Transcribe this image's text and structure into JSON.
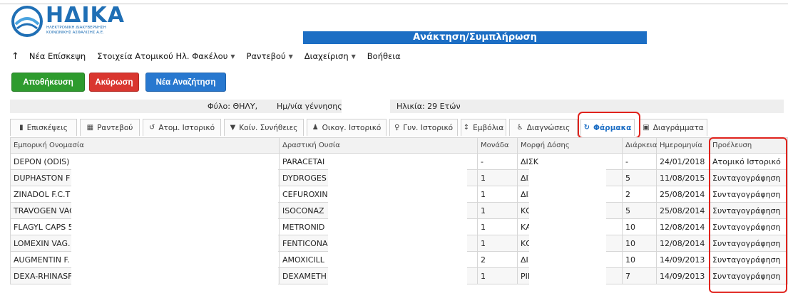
{
  "logo": {
    "word": "ΗΔΙΚΑ",
    "subtitle": "ΗΛΕΚΤΡΟΝΙΚΗ ΔΙΑΚΥΒΕΡΝΗΣΗ ΚΟΙΝΩΝΙΚΗΣ ΑΣΦΑΛΙΣΗΣ Α.Ε."
  },
  "banner": {
    "title": "Ανάκτηση/Συμπλήρωση"
  },
  "nav": {
    "items": [
      {
        "label": "Νέα Επίσκεψη"
      },
      {
        "label": "Στοιχεία Ατομικού Ηλ. Φακέλου"
      },
      {
        "label": "Ραντεβού"
      },
      {
        "label": "Διαχείριση"
      },
      {
        "label": "Βοήθεια"
      }
    ]
  },
  "buttons": {
    "save": "Αποθήκευση",
    "cancel": "Ακύρωση",
    "new_search": "Νέα Αναζήτηση"
  },
  "patient": {
    "gender": "Φύλο: ΘΗΛΥ,",
    "birth": "Ημ/νία γέννησης:",
    "age": "Ηλικία: 29 Ετών"
  },
  "tabs": [
    {
      "label": "Επισκέψεις",
      "icon": "visits-icon"
    },
    {
      "label": "Ραντεβού",
      "icon": "calendar-icon"
    },
    {
      "label": "Ατομ. Ιστορικό",
      "icon": "history-icon"
    },
    {
      "label": "Κοίν. Συνήθειες",
      "icon": "filter-icon"
    },
    {
      "label": "Οικογ. Ιστορικό",
      "icon": "person-icon"
    },
    {
      "label": "Γυν. Ιστορικό",
      "icon": "female-icon"
    },
    {
      "label": "Εμβόλια",
      "icon": "syringe-icon"
    },
    {
      "label": "Διαγνώσεις",
      "icon": "accessibility-icon"
    },
    {
      "label": "Φάρμακα",
      "icon": "pill-icon",
      "active": true
    },
    {
      "label": "Διαγράμματα",
      "icon": "chart-icon"
    }
  ],
  "table": {
    "headers": [
      "Εμπορική Ονομασία",
      "Δραστική Ουσία",
      "Μονάδα",
      "Μορφή Δόσης",
      "Διάρκεια",
      "Ημερομηνία",
      "Προέλευση"
    ],
    "rows": [
      [
        "DEPON (ODIS)",
        "PARACETAI",
        "-",
        "ΔΙΣΚ",
        "-",
        "24/01/2018",
        "Ατομικό Ιστορικό"
      ],
      [
        "DUPHASTON F",
        "DYDROGES",
        "1",
        "ΔΙΣΚ",
        "5",
        "11/08/2015",
        "Συνταγογράφηση"
      ],
      [
        "ZINADOL F.C.T",
        "CEFUROXIN",
        "1",
        "ΔΙΣΚ",
        "2",
        "25/08/2014",
        "Συνταγογράφηση"
      ],
      [
        "TRAVOGEN VAG",
        "ISOCONAZ",
        "1",
        "ΚΟΛΠ",
        "5",
        "25/08/2014",
        "Συνταγογράφηση"
      ],
      [
        "FLAGYL CAPS 5",
        "METRONID",
        "1",
        "ΚΑΨ",
        "10",
        "12/08/2014",
        "Συνταγογράφηση"
      ],
      [
        "LOMEXIN VAG.",
        "FENTICONA",
        "1",
        "ΚΟΛΠ",
        "10",
        "12/08/2014",
        "Συνταγογράφηση"
      ],
      [
        "AUGMENTIN F.",
        "AMOXICILL",
        "2",
        "ΔΙΣΚ",
        "10",
        "14/09/2013",
        "Συνταγογράφηση"
      ],
      [
        "DEXA-RHINASF",
        "DEXAMETH",
        "1",
        "ΡΙΝΙΚ",
        "7",
        "14/09/2013",
        "Συνταγογράφηση"
      ]
    ]
  },
  "colors": {
    "brand_blue": "#1c6ec4",
    "save_green": "#2e9b2e",
    "cancel_red": "#d9362f",
    "annotation_red": "#e0231d"
  }
}
